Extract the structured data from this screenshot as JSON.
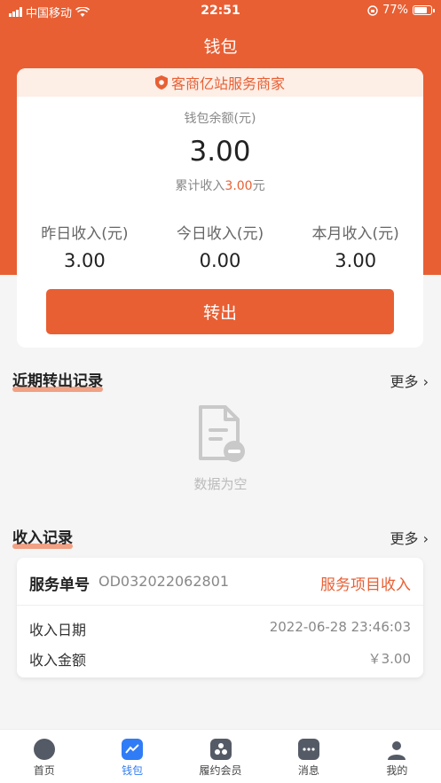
{
  "status_bar": {
    "carrier": "中国移动",
    "time": "22:51",
    "battery": "77%"
  },
  "nav": {
    "title": "钱包"
  },
  "wallet": {
    "merchant": "客商亿站服务商家",
    "balance_label": "钱包余额(元)",
    "balance": "3.00",
    "cumulative_label": "累计收入",
    "cumulative_value": "3.00",
    "cumulative_unit": "元",
    "stats": [
      {
        "label": "昨日收入(元)",
        "value": "3.00"
      },
      {
        "label": "今日收入(元)",
        "value": "0.00"
      },
      {
        "label": "本月收入(元)",
        "value": "3.00"
      }
    ],
    "transfer_button": "转出"
  },
  "recent_transfers": {
    "title": "近期转出记录",
    "more": "更多",
    "empty_text": "数据为空"
  },
  "income": {
    "title": "收入记录",
    "more": "更多",
    "record": {
      "order_label": "服务单号",
      "order_no": "OD032022062801",
      "type": "服务项目收入",
      "date_label": "收入日期",
      "date": "2022-06-28 23:46:03",
      "amount_label": "收入金额",
      "amount": "￥3.00"
    }
  },
  "tabs": [
    {
      "label": "首页",
      "icon": "dashboard-icon"
    },
    {
      "label": "钱包",
      "icon": "wallet-chart-icon",
      "active": true
    },
    {
      "label": "履约会员",
      "icon": "members-icon"
    },
    {
      "label": "消息",
      "icon": "message-icon"
    },
    {
      "label": "我的",
      "icon": "profile-icon"
    }
  ],
  "colors": {
    "accent": "#e85f33",
    "tab_active": "#2f7cf6"
  }
}
